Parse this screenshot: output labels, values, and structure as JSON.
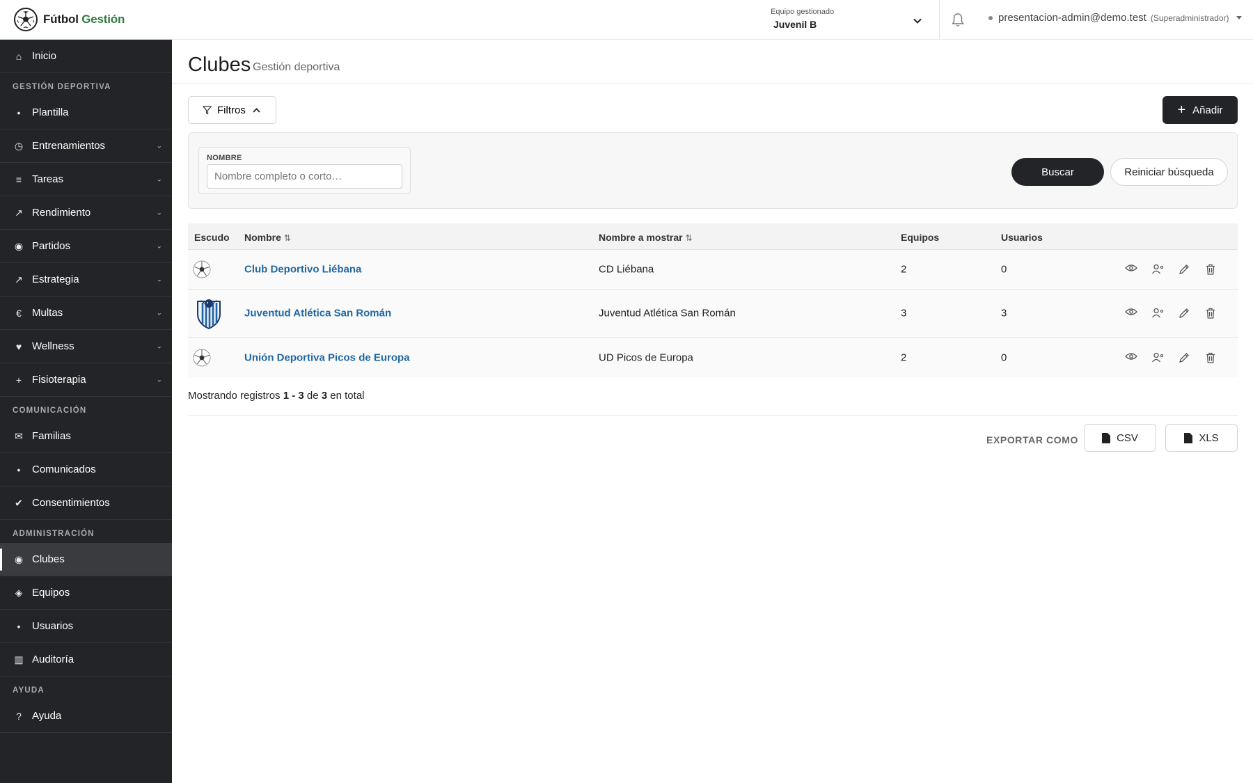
{
  "brand": {
    "name_part1": "Fútbol ",
    "name_part2": "Gestión",
    "accent_color": "#2f7a3e",
    "icon": "soccer-ball-icon"
  },
  "team_selector": {
    "caption": "Equipo gestionado",
    "value": "Juvenil B"
  },
  "user": {
    "email": "presentacion-admin@demo.test",
    "role": "(Superadministrador)"
  },
  "sidebar": {
    "home": {
      "label": "Inicio",
      "icon": "home-icon"
    },
    "section_sports": "GESTIÓN DEPORTIVA",
    "sports_items": [
      {
        "label": "Plantilla",
        "icon": "bullet-icon",
        "expandable": false
      },
      {
        "label": "Entrenamientos",
        "icon": "clock-icon",
        "expandable": true
      },
      {
        "label": "Tareas",
        "icon": "list-icon",
        "expandable": true
      },
      {
        "label": "Rendimiento",
        "icon": "trend-arrow-icon",
        "expandable": true
      },
      {
        "label": "Partidos",
        "icon": "target-icon",
        "expandable": true
      },
      {
        "label": "Estrategia",
        "icon": "trend-arrow-icon",
        "expandable": true
      },
      {
        "label": "Multas",
        "icon": "euro-icon",
        "expandable": true
      },
      {
        "label": "Wellness",
        "icon": "heart-icon",
        "expandable": true
      },
      {
        "label": "Fisioterapia",
        "icon": "plus-icon",
        "expandable": true
      }
    ],
    "section_comm": "COMUNICACIÓN",
    "comm_items": [
      {
        "label": "Familias",
        "icon": "envelope-icon"
      },
      {
        "label": "Comunicados",
        "icon": "bullet-icon"
      },
      {
        "label": "Consentimientos",
        "icon": "check-icon"
      }
    ],
    "section_admin": "ADMINISTRACIÓN",
    "admin_items": [
      {
        "label": "Clubes",
        "icon": "target-icon",
        "active": true
      },
      {
        "label": "Equipos",
        "icon": "diamond-icon",
        "active": false
      },
      {
        "label": "Usuarios",
        "icon": "bullet-icon",
        "active": false
      },
      {
        "label": "Auditoría",
        "icon": "ledger-icon",
        "active": false
      }
    ],
    "section_help": "AYUDA",
    "help_item": {
      "label": "Ayuda",
      "icon": "question-icon"
    }
  },
  "page": {
    "title": "Clubes",
    "subtitle": "Gestión deportiva"
  },
  "toolbar": {
    "filters_label": "Filtros",
    "add_label": "Añadir"
  },
  "filters": {
    "name_label": "NOMBRE",
    "name_placeholder": "Nombre completo o corto…",
    "search_label": "Buscar",
    "reset_label": "Reiniciar búsqueda"
  },
  "table": {
    "columns": {
      "crest": "Escudo",
      "name": "Nombre",
      "display_name": "Nombre a mostrar",
      "teams": "Equipos",
      "users": "Usuarios"
    },
    "rows": [
      {
        "crest": "soccer-ball-icon",
        "name": "Club Deportivo Liébana",
        "display_name": "CD Liébana",
        "teams": "2",
        "users": "0"
      },
      {
        "crest": "club-crest-icon",
        "name": "Juventud Atlética San Román",
        "display_name": "Juventud Atlética San Román",
        "teams": "3",
        "users": "3"
      },
      {
        "crest": "soccer-ball-icon",
        "name": "Unión Deportiva Picos de Europa",
        "display_name": "UD Picos de Europa",
        "teams": "2",
        "users": "0"
      }
    ]
  },
  "summary": {
    "prefix": "Mostrando registros ",
    "range": "1 - 3",
    "middle": " de ",
    "total": "3",
    "suffix": " en total"
  },
  "export": {
    "label": "EXPORTAR COMO",
    "csv": "CSV",
    "xls": "XLS"
  }
}
